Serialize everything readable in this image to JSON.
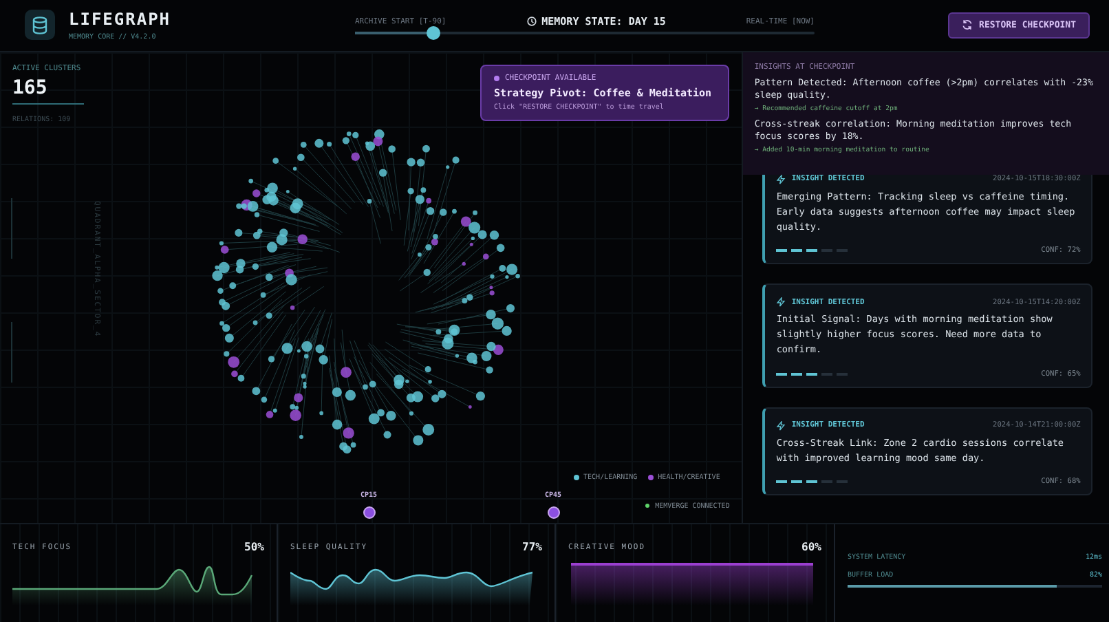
{
  "header": {
    "title": "LIFEGRAPH",
    "subtitle": "MEMORY CORE // V4.2.0",
    "restore_button": "RESTORE CHECKPOINT"
  },
  "timeline": {
    "start_label": "ARCHIVE START [T-90]",
    "state_label": "MEMORY STATE: DAY 15",
    "end_label": "REAL-TIME [NOW]",
    "level": 0.17
  },
  "stats": {
    "label": "ACTIVE CLUSTERS",
    "value": "165",
    "relations": "RELATIONS: 109",
    "sector": "QUADRANT_ALPHA_SECTOR_4"
  },
  "checkpoint_popup": {
    "badge": "CHECKPOINT AVAILABLE",
    "title": "Strategy Pivot: Coffee & Meditation",
    "hint": "Click \"RESTORE CHECKPOINT\" to time travel"
  },
  "legend": [
    {
      "label": "TECH/LEARNING",
      "color": "#5fc4d4"
    },
    {
      "label": "HEALTH/CREATIVE",
      "color": "#9b4fd6"
    }
  ],
  "checkpoints": [
    {
      "label": "CP15",
      "selected": true
    },
    {
      "label": "CP45",
      "selected": true
    }
  ],
  "connection": {
    "label": "MEMVERGE CONNECTED",
    "on": true
  },
  "checkpoint_insights": {
    "title": "INSIGHTS AT CHECKPOINT",
    "items": [
      {
        "text": "Pattern Detected: Afternoon coffee (>2pm) correlates with -23% sleep quality.",
        "note": "→ Recommended caffeine cutoff at 2pm"
      },
      {
        "text": "Cross-streak correlation: Morning meditation improves tech focus scores by 18%.",
        "note": "→ Added 10-min morning meditation to routine"
      }
    ]
  },
  "insights": [
    {
      "label": "INSIGHT DETECTED",
      "time": "2024-10-15T18:30:00Z",
      "text": "Emerging Pattern: Tracking sleep vs caffeine timing. Early data suggests afternoon coffee may impact sleep quality.",
      "level": 0.6,
      "confidence": "CONF: 72%"
    },
    {
      "label": "INSIGHT DETECTED",
      "time": "2024-10-15T14:20:00Z",
      "text": "Initial Signal: Days with morning meditation show slightly higher focus scores. Need more data to confirm.",
      "level": 0.6,
      "confidence": "CONF: 65%"
    },
    {
      "label": "INSIGHT DETECTED",
      "time": "2024-10-14T21:00:00Z",
      "text": "Cross-Streak Link: Zone 2 cardio sessions correlate with improved learning mood same day.",
      "level": 0.6,
      "confidence": "CONF: 68%"
    }
  ],
  "metrics": [
    {
      "kind": "wave",
      "label": "TECH FOCUS",
      "value": "50%",
      "color": "#5aa878"
    },
    {
      "kind": "wave",
      "label": "SLEEP QUALITY",
      "value": "77%",
      "color": "#5fc4d4"
    },
    {
      "kind": "flat",
      "label": "CREATIVE MOOD",
      "value": "60%",
      "color": "#9b3fd0"
    }
  ],
  "system": [
    {
      "label": "SYSTEM LATENCY",
      "value": "12ms"
    },
    {
      "label": "BUFFER LOAD",
      "value": "82%",
      "level": 0.82
    }
  ]
}
